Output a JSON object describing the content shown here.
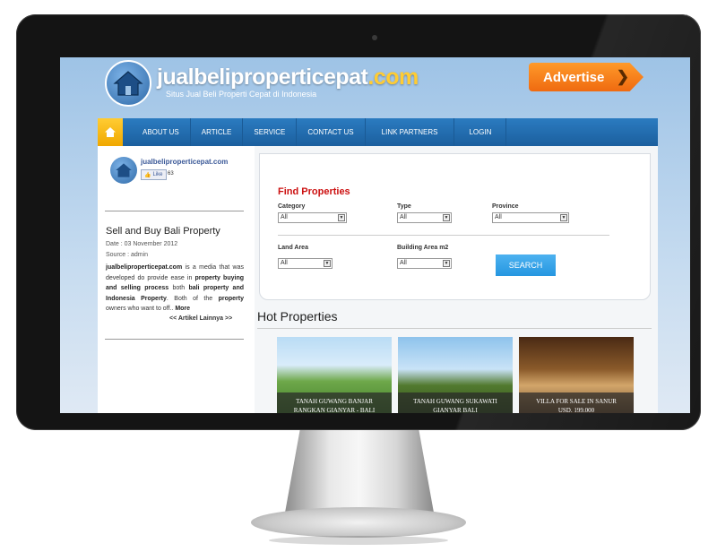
{
  "header": {
    "site_name_main": "jualbeliproperticepat",
    "site_name_tld": ".com",
    "tagline": "Situs Jual Beli Properti Cepat di Indonesia",
    "advertise_label": "Advertise",
    "logo_icon": "house-icon"
  },
  "nav": {
    "home_icon": "home-icon",
    "items": [
      "ABOUT US",
      "ARTICLE",
      "SERVICE",
      "CONTACT US",
      "LINK PARTNERS",
      "LOGIN"
    ]
  },
  "facebook": {
    "page_name": "jualbeliproperticepat.com",
    "like_label": "Like",
    "like_count": "63"
  },
  "post": {
    "title": "Sell and Buy Bali Property",
    "date": "Date : 03 November 2012",
    "source": "Source : admin",
    "body_site": "jualbeliproperticepat.com",
    "body_1": " is a media that was developed do provide ease in ",
    "body_bold_1": "property buying and selling process",
    "body_2": " both ",
    "body_bold_2": "bali property and Indonesia Property",
    "body_3": ". Both of the ",
    "body_bold_3": "property",
    "body_4": " owners who want to off.. ",
    "body_more": "More",
    "more_link": "<< Artikel Lainnya >>"
  },
  "search": {
    "title": "Find Properties",
    "category_label": "Category",
    "category_value": "All",
    "type_label": "Type",
    "type_value": "All",
    "province_label": "Province",
    "province_value": "All",
    "land_area_label": "Land Area",
    "land_area_value": "All",
    "building_area_label": "Building Area m2",
    "building_area_value": "All",
    "button_label": "SEARCH"
  },
  "hot": {
    "title": "Hot Properties",
    "prev": "<<",
    "next": ">>",
    "cards": [
      {
        "line1": "TANAH GUWANG BANJAR",
        "line2": "RANGKAN GIANYAR - BALI"
      },
      {
        "line1": "TANAH GUWANG SUKAWATI",
        "line2": "GIANYAR BALI"
      },
      {
        "line1": "VILLA FOR SALE IN SANUR",
        "line2": "USD.  199.000"
      }
    ]
  },
  "colors": {
    "nav_blue": "#1b5f9e",
    "advertise_orange": "#ef6a10",
    "find_title_red": "#cc1111",
    "search_button_blue": "#2596e0",
    "tld_yellow": "#ffcc33"
  }
}
